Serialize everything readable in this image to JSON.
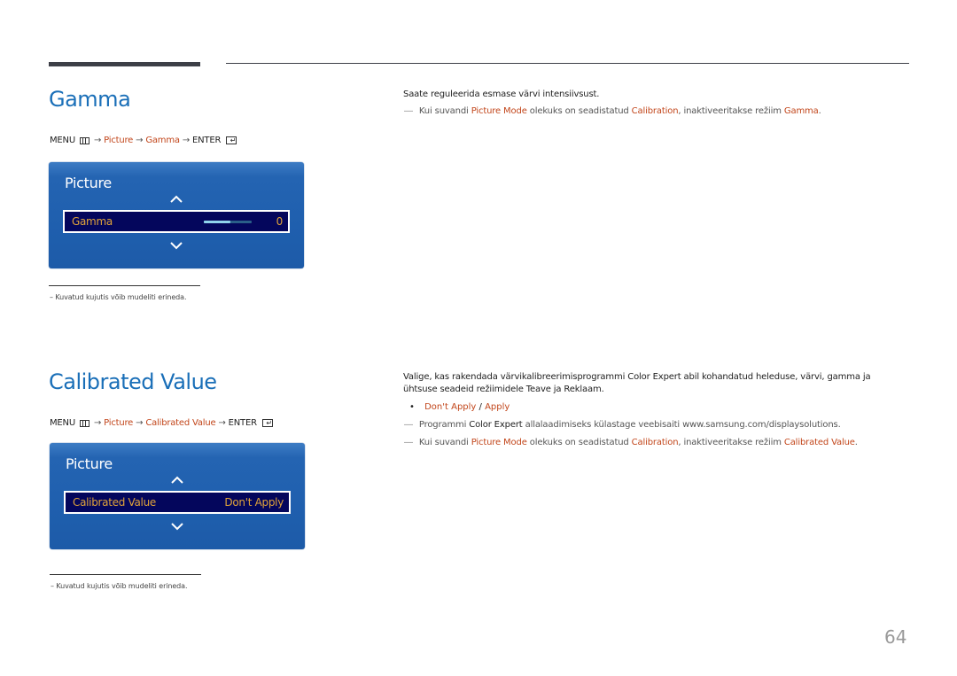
{
  "sections": [
    {
      "title": "Gamma",
      "path": {
        "menu": "MENU",
        "steps": [
          "Picture",
          "Gamma"
        ],
        "enter": "ENTER"
      },
      "osd": {
        "title": "Picture",
        "row_label": "Gamma",
        "row_value": "0",
        "slider_fraction": 0.55
      },
      "description": "Saate reguleerida esmase värvi intensiivsust.",
      "note": {
        "pre": "Kui suvandi",
        "hl1": "Picture Mode",
        "mid": "olekuks on seadistatud",
        "hl2": "Calibration",
        "mid2": ", inaktiveeritakse režiim",
        "hl3": "Gamma",
        "end": "."
      },
      "footnote": "Kuvatud kujutis võib mudeliti erineda."
    },
    {
      "title": "Calibrated Value",
      "path": {
        "menu": "MENU",
        "steps": [
          "Picture",
          "Calibrated Value"
        ],
        "enter": "ENTER"
      },
      "osd": {
        "title": "Picture",
        "row_label": "Calibrated Value",
        "row_value": "Don't Apply"
      },
      "description": {
        "pre": "Valige, kas rakendada värvikalibreerimisprogrammi",
        "bold": "Color Expert",
        "post": "abil kohandatud heleduse, värvi, gamma ja",
        "line2": "ühtsuse seadeid režiimidele Teave ja Reklaam."
      },
      "options": {
        "opt1": "Don't Apply",
        "sep": "/",
        "opt2": "Apply"
      },
      "note1": {
        "pre": "Programmi",
        "bold": "Color Expert",
        "post": "allalaadimiseks külastage veebisaiti www.samsung.com/displaysolutions."
      },
      "note2": {
        "pre": "Kui suvandi",
        "hl1": "Picture Mode",
        "mid": "olekuks on seadistatud",
        "hl2": "Calibration",
        "mid2": ", inaktiveeritakse režiim",
        "hl3": "Calibrated Value",
        "end": "."
      },
      "footnote": "Kuvatud kujutis võib mudeliti erineda."
    }
  ],
  "symbols": {
    "arrow": "→",
    "note_dash": "―",
    "footnote_dash": "–",
    "bullet": "•"
  },
  "page_number": "64",
  "colors": {
    "title": "#1a6fb8",
    "highlight": "#c2461b",
    "osd_row_text": "#e0a33a",
    "osd_bg": "#1f5fae"
  }
}
